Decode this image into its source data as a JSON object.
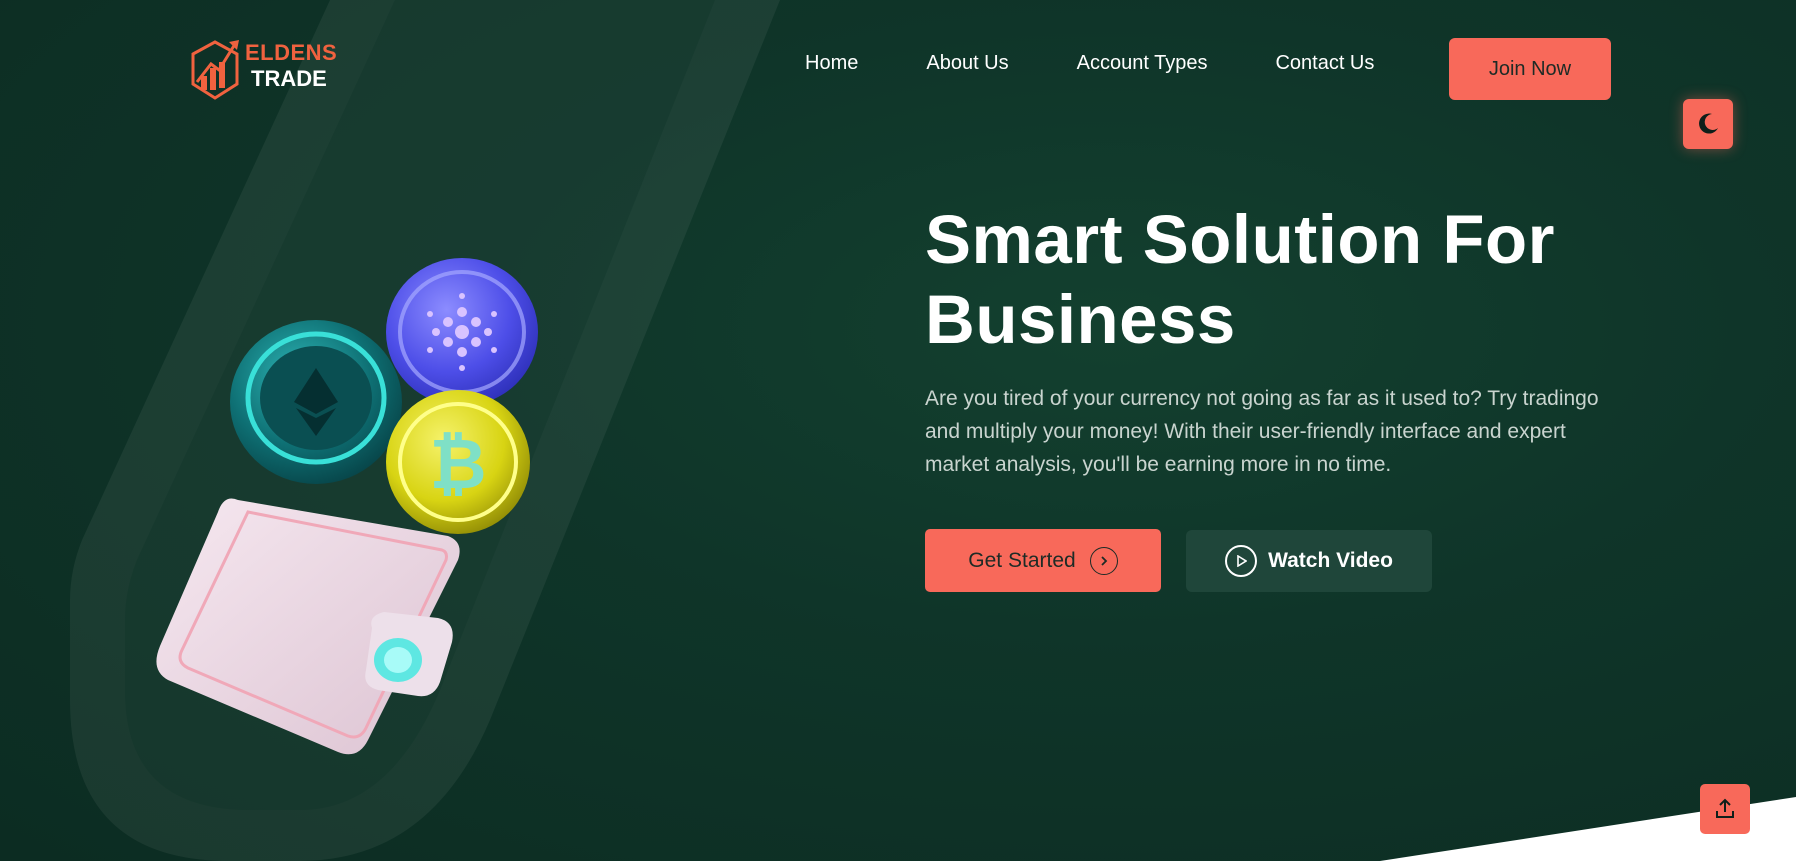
{
  "header": {
    "logo": {
      "line1": "ELDENS",
      "line2": "TRADE"
    },
    "nav": [
      {
        "label": "Home"
      },
      {
        "label": "About Us"
      },
      {
        "label": "Account Types"
      },
      {
        "label": "Contact Us"
      }
    ],
    "join_label": "Join Now"
  },
  "hero": {
    "title_line1": "Smart Solution For",
    "title_line2": "Business",
    "description": "Are you tired of your currency not going as far as it used to? Try tradingo and multiply your money! With their user-friendly interface and expert market analysis, you'll be earning more in no time.",
    "get_started_label": "Get Started",
    "watch_video_label": "Watch Video"
  },
  "icons": {
    "theme_toggle": "moon-icon",
    "get_started_arrow": "chevron-right-icon",
    "watch_video": "play-icon",
    "scroll_top": "upload-arrow-icon"
  },
  "colors": {
    "accent": "#f8695a",
    "background": "#0f3529",
    "secondary_button": "#1f463a",
    "logo_accent": "#f0623f"
  }
}
